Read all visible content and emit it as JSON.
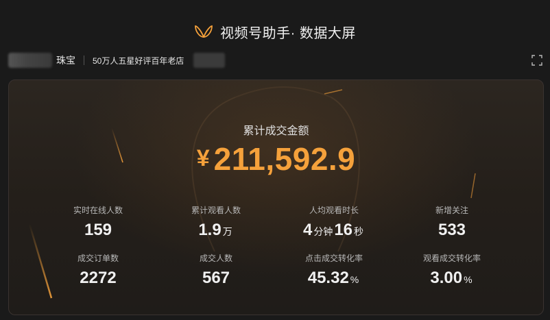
{
  "app": {
    "title": "视频号助手· 数据大屏"
  },
  "shop": {
    "name": "珠宝",
    "tagline": "50万人五星好评百年老店"
  },
  "total": {
    "label": "累计成交金额",
    "currency": "¥",
    "value": "211,592.9"
  },
  "stats": [
    {
      "label": "实时在线人数",
      "value": "159"
    },
    {
      "label": "累计观看人数",
      "value": "1.9",
      "unit": "万"
    },
    {
      "label": "人均观看时长",
      "v1": "4",
      "u1": "分钟",
      "v2": "16",
      "u2": "秒"
    },
    {
      "label": "新增关注",
      "value": "533"
    },
    {
      "label": "成交订单数",
      "value": "2272"
    },
    {
      "label": "成交人数",
      "value": "567"
    },
    {
      "label": "点击成交转化率",
      "value": "45.32",
      "unit": "%"
    },
    {
      "label": "观看成交转化率",
      "value": "3.00",
      "unit": "%"
    }
  ],
  "colors": {
    "accent": "#f5a13b",
    "background": "#1a1a1a"
  },
  "icons": {
    "logo": "butterfly-logo-icon",
    "fullscreen": "fullscreen-icon"
  }
}
